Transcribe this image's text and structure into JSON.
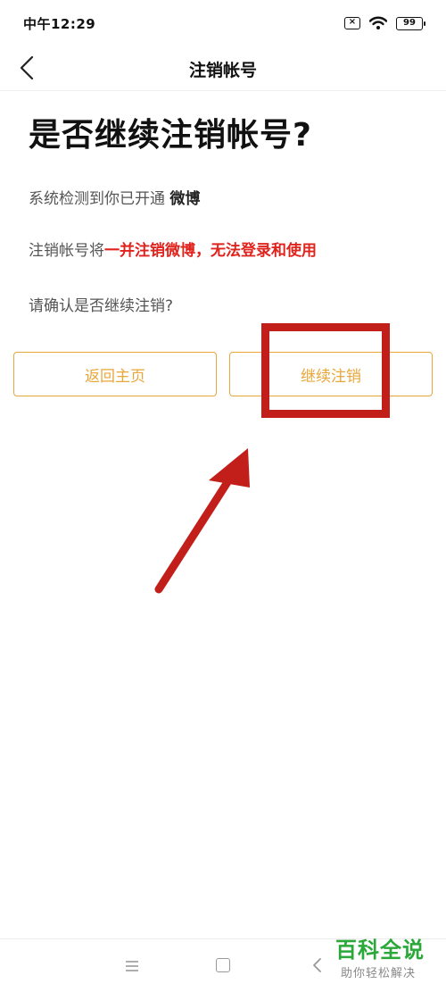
{
  "status_bar": {
    "time": "中午12:29",
    "sim_icon": "sim-missing-icon",
    "wifi_icon": "wifi-icon",
    "battery_level": "99"
  },
  "header": {
    "back_icon": "chevron-left-icon",
    "title": "注销帐号"
  },
  "main": {
    "headline": "是否继续注销帐号?",
    "detect_text": "系统检测到你已开通 ",
    "detect_service": "微博",
    "warning_prefix": "注销帐号将",
    "warning_red": "一并注销微博，无法登录和使用",
    "confirm_text": "请确认是否继续注销?"
  },
  "buttons": {
    "home_label": "返回主页",
    "continue_label": "继续注销"
  },
  "annotation": {
    "highlight_color": "#c21f1a",
    "arrow_color": "#c21f1a"
  },
  "system_nav": {
    "menu_icon": "menu-icon",
    "home_icon": "square-home-icon",
    "back_icon": "back-triangle-icon"
  },
  "watermark": {
    "title": "百科全说",
    "subtitle": "助你轻松解决"
  },
  "colors": {
    "accent": "#e9a63a",
    "warning": "#e0231d",
    "watermark": "#2aa83a"
  }
}
